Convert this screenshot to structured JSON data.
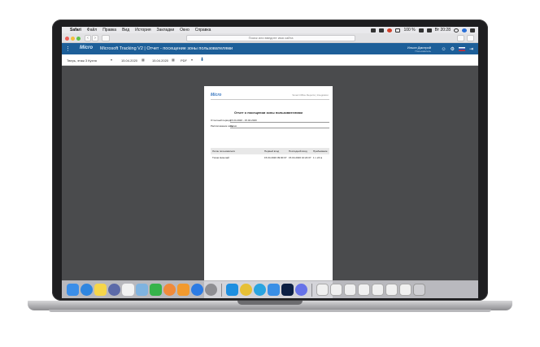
{
  "menubar": {
    "app": "Safari",
    "menus": [
      "Файл",
      "Правка",
      "Вид",
      "История",
      "Закладки",
      "Окно",
      "Справка"
    ],
    "clock": "Вт 20:28",
    "battery": "100 %"
  },
  "browser": {
    "address_placeholder": "Поиск или введите имя сайта"
  },
  "app": {
    "logo": "Micro",
    "title": "Microsoft Tracking V2 | Отчет - посещение зоны пользователями",
    "user_name": "Ильин Дмитрий",
    "user_role": "Пользователь"
  },
  "filters": {
    "zone": "Тверь, этаж 3 Кухня",
    "date_from": "15.04.2020",
    "date_to": "15.04.2020",
    "format": "PDF"
  },
  "report": {
    "logo": "Micro",
    "tag": "Smart Office Reports | Integration",
    "title": "Отчет о посещении зоны пользователями",
    "period_label": "Отчетный период",
    "period_value": "15.04.2020 - 15.04.2020",
    "zone_label": "Расположение зоны",
    "zone_value": "Кухня",
    "columns": [
      "Логин пользователя",
      "Первый вход",
      "Последний вход",
      "Пребывание"
    ],
    "rows": [
      {
        "login": "Тихов Николай",
        "first": "15.04.2020 09:00:07",
        "last": "15.04.2020 10:24:07",
        "stay": "1 ч 24 м"
      }
    ]
  },
  "colors": {
    "app_header": "#1d5f99",
    "screen_bg": "#4a4b4d"
  },
  "dock_icons": [
    "finder-icon",
    "safari-icon",
    "notes-icon",
    "launchpad-icon",
    "calendar-icon",
    "preview-icon",
    "facetime-icon",
    "photos-icon",
    "pages-icon",
    "appstore-icon",
    "settings-icon",
    "skype-icon",
    "chrome-icon",
    "telegram-icon",
    "keynote-icon",
    "photoshop-icon",
    "discord-icon",
    "window-icon",
    "window-icon",
    "window-icon",
    "window-icon",
    "window-icon",
    "window-icon",
    "window-icon",
    "trash-icon"
  ]
}
